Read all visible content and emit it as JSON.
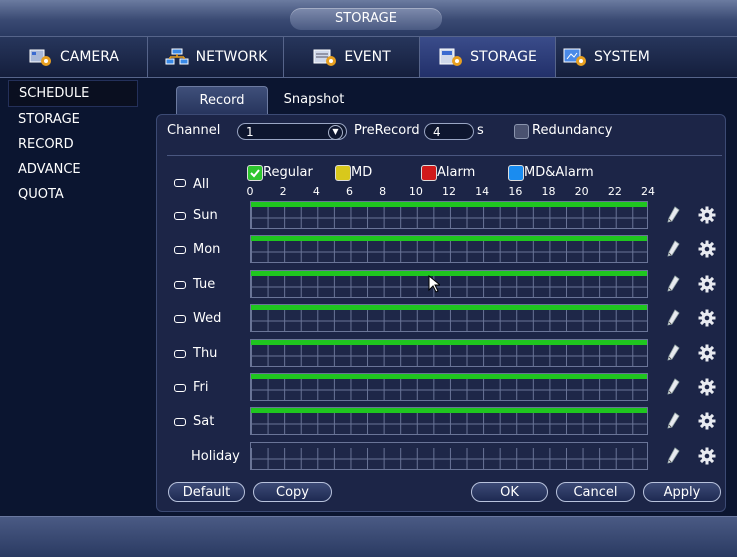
{
  "window": {
    "title": "STORAGE"
  },
  "tabs": [
    {
      "label": "CAMERA",
      "icon": "camera-icon"
    },
    {
      "label": "NETWORK",
      "icon": "network-icon"
    },
    {
      "label": "EVENT",
      "icon": "event-icon"
    },
    {
      "label": "STORAGE",
      "icon": "storage-icon",
      "active": true
    },
    {
      "label": "SYSTEM",
      "icon": "system-icon"
    }
  ],
  "sidebar": {
    "items": [
      {
        "label": "SCHEDULE",
        "active": true
      },
      {
        "label": "STORAGE"
      },
      {
        "label": "RECORD"
      },
      {
        "label": "ADVANCE"
      },
      {
        "label": "QUOTA"
      }
    ]
  },
  "subtabs": [
    {
      "label": "Record",
      "active": true
    },
    {
      "label": "Snapshot"
    }
  ],
  "form": {
    "channel_label": "Channel",
    "channel_value": "1",
    "prerecord_label": "PreRecord",
    "prerecord_value": "4",
    "prerecord_unit": "s",
    "redundancy_label": "Redundancy"
  },
  "legend": [
    {
      "label": "Regular",
      "color": "#2ec52e",
      "checked": true
    },
    {
      "label": "MD",
      "color": "#d8c81c"
    },
    {
      "label": "Alarm",
      "color": "#d01a1a"
    },
    {
      "label": "MD&Alarm",
      "color": "#1a8cf0"
    }
  ],
  "all_label": "All",
  "hours": [
    "0",
    "2",
    "4",
    "6",
    "8",
    "10",
    "12",
    "14",
    "16",
    "18",
    "20",
    "22",
    "24"
  ],
  "days": [
    {
      "label": "Sun",
      "regular_fraction": 1.0
    },
    {
      "label": "Mon",
      "regular_fraction": 1.0
    },
    {
      "label": "Tue",
      "regular_fraction": 1.0
    },
    {
      "label": "Wed",
      "regular_fraction": 1.0
    },
    {
      "label": "Thu",
      "regular_fraction": 1.0
    },
    {
      "label": "Fri",
      "regular_fraction": 1.0
    },
    {
      "label": "Sat",
      "regular_fraction": 1.0
    },
    {
      "label": "Holiday",
      "regular_fraction": 0.0
    }
  ],
  "buttons": {
    "default": "Default",
    "copy": "Copy",
    "ok": "OK",
    "cancel": "Cancel",
    "apply": "Apply"
  }
}
